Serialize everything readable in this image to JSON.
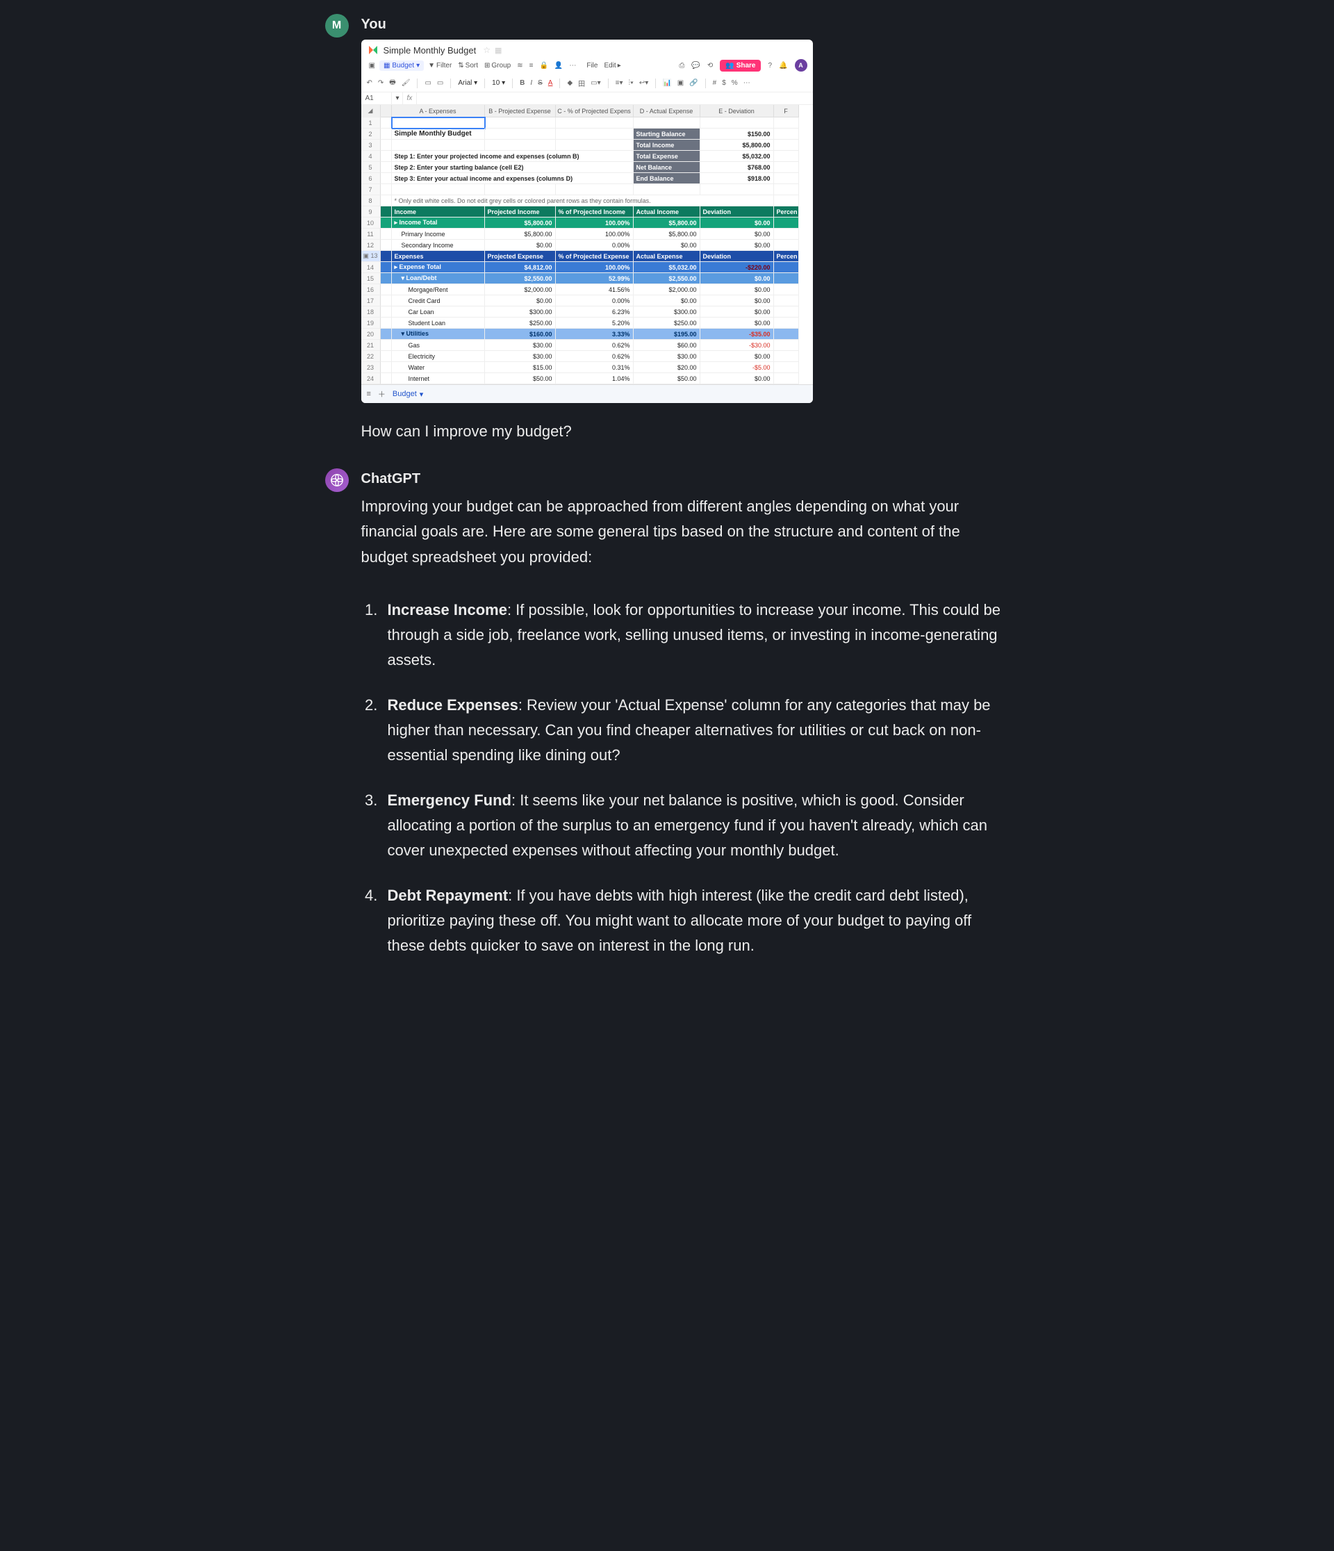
{
  "user": {
    "sender": "You",
    "avatar_letter": "M",
    "prompt": "How can I improve my budget?"
  },
  "assistant": {
    "sender": "ChatGPT",
    "intro": "Improving your budget can be approached from different angles depending on what your financial goals are. Here are some general tips based on the structure and content of the budget spreadsheet you provided:",
    "tips": [
      {
        "title": "Increase Income",
        "body": ": If possible, look for opportunities to increase your income. This could be through a side job, freelance work, selling unused items, or investing in income-generating assets."
      },
      {
        "title": "Reduce Expenses",
        "body": ": Review your 'Actual Expense' column for any categories that may be higher than necessary. Can you find cheaper alternatives for utilities or cut back on non-essential spending like dining out?"
      },
      {
        "title": "Emergency Fund",
        "body": ": It seems like your net balance is positive, which is good. Consider allocating a portion of the surplus to an emergency fund if you haven't already, which can cover unexpected expenses without affecting your monthly budget."
      },
      {
        "title": "Debt Repayment",
        "body": ": If you have debts with high interest (like the credit card debt listed), prioritize paying these off. You might want to allocate more of your budget to paying off these debts quicker to save on interest in the long run."
      }
    ]
  },
  "spreadsheet": {
    "doc_title": "Simple Monthly Budget",
    "view_chip": "Budget",
    "menubar": [
      "Filter",
      "Sort",
      "Group"
    ],
    "file_menu": "File",
    "edit_menu": "Edit",
    "share": "Share",
    "mini_avatar": "A",
    "font": "Arial",
    "font_size": "10",
    "cell_ref": "A1",
    "fx": "fx",
    "col_headers": [
      "A - Expenses",
      "B - Projected Expense",
      "C - % of Projected Expens",
      "D - Actual Expense",
      "E - Deviation",
      "F"
    ],
    "summary": [
      {
        "label": "Starting Balance",
        "value": "$150.00"
      },
      {
        "label": "Total Income",
        "value": "$5,800.00"
      },
      {
        "label": "Total Expense",
        "value": "$5,032.00"
      },
      {
        "label": "Net Balance",
        "value": "$768.00"
      },
      {
        "label": "End Balance",
        "value": "$918.00"
      }
    ],
    "title_text": "Simple Monthly Budget",
    "steps": [
      "Step 1: Enter your projected income and expenses (column B)",
      "Step 2: Enter your starting balance (cell E2)",
      "Step 3: Enter your actual income and expenses (columns D)"
    ],
    "note": "* Only edit white cells. Do not edit grey cells or colored parent rows as they contain formulas.",
    "income_header": [
      "Income",
      "Projected Income",
      "% of Projected Income",
      "Actual Income",
      "Deviation",
      "Percen"
    ],
    "income_total": [
      "Income Total",
      "$5,800.00",
      "100.00%",
      "$5,800.00",
      "$0.00",
      ""
    ],
    "income_rows": [
      [
        "Primary Income",
        "$5,800.00",
        "100.00%",
        "$5,800.00",
        "$0.00",
        ""
      ],
      [
        "Secondary Income",
        "$0.00",
        "0.00%",
        "$0.00",
        "$0.00",
        ""
      ]
    ],
    "expense_header": [
      "Expenses",
      "Projected Expense",
      "% of Projected Expense",
      "Actual Expense",
      "Deviation",
      "Percen"
    ],
    "expense_total": [
      "Expense Total",
      "$4,812.00",
      "100.00%",
      "$5,032.00",
      "-$220.00",
      ""
    ],
    "loan_row": [
      "Loan/Debt",
      "$2,550.00",
      "52.99%",
      "$2,550.00",
      "$0.00",
      ""
    ],
    "loan_children": [
      [
        "Morgage/Rent",
        "$2,000.00",
        "41.56%",
        "$2,000.00",
        "$0.00",
        ""
      ],
      [
        "Credit Card",
        "$0.00",
        "0.00%",
        "$0.00",
        "$0.00",
        ""
      ],
      [
        "Car Loan",
        "$300.00",
        "6.23%",
        "$300.00",
        "$0.00",
        ""
      ],
      [
        "Student Loan",
        "$250.00",
        "5.20%",
        "$250.00",
        "$0.00",
        ""
      ]
    ],
    "util_row": [
      "Utilities",
      "$160.00",
      "3.33%",
      "$195.00",
      "-$35.00",
      ""
    ],
    "util_children": [
      [
        "Gas",
        "$30.00",
        "0.62%",
        "$60.00",
        "-$30.00",
        ""
      ],
      [
        "Electricity",
        "$30.00",
        "0.62%",
        "$30.00",
        "$0.00",
        ""
      ],
      [
        "Water",
        "$15.00",
        "0.31%",
        "$20.00",
        "-$5.00",
        ""
      ],
      [
        "Internet",
        "$50.00",
        "1.04%",
        "$50.00",
        "$0.00",
        ""
      ]
    ],
    "footer_tab": "Budget"
  }
}
